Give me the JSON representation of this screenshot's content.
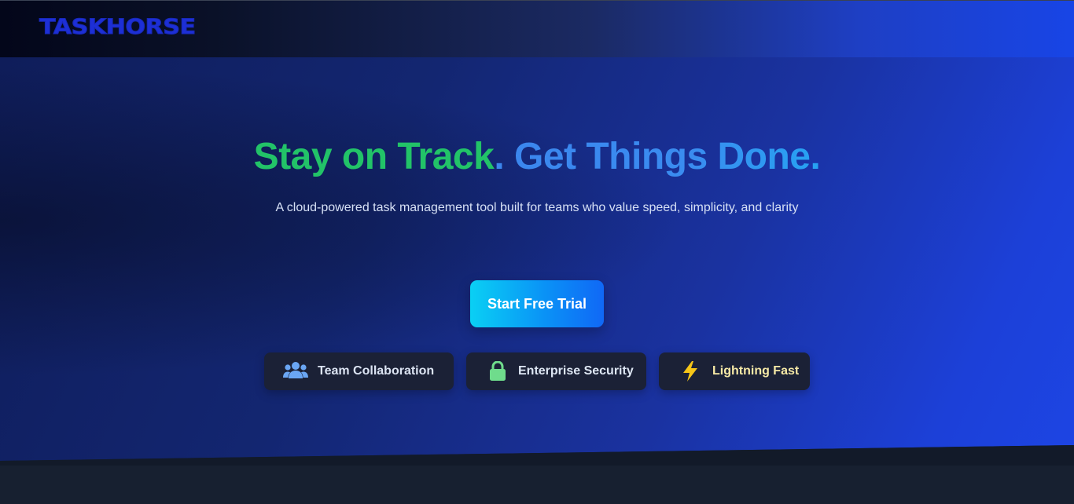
{
  "header": {
    "logo_text": "TASKHORSE"
  },
  "hero": {
    "headline_part1": "Stay on Track",
    "headline_part2": ". Get Things Done.",
    "subtitle": "A cloud-powered task management tool built for teams who value speed, simplicity, and clarity",
    "cta_label": "Start Free Trial"
  },
  "features": [
    {
      "label": "Team Collaboration",
      "icon": "users-icon",
      "icon_color": "#6aa6f4"
    },
    {
      "label": "Enterprise Security",
      "icon": "lock-icon",
      "icon_color": "#6fdc8c"
    },
    {
      "label": "Lightning Fast",
      "icon": "lightning-icon",
      "icon_color": "#f5c518"
    }
  ],
  "colors": {
    "accent_green": "#22c368",
    "accent_blue": "#3b86ee",
    "cta_start": "#0ad0f4",
    "cta_end": "#1068f6"
  }
}
